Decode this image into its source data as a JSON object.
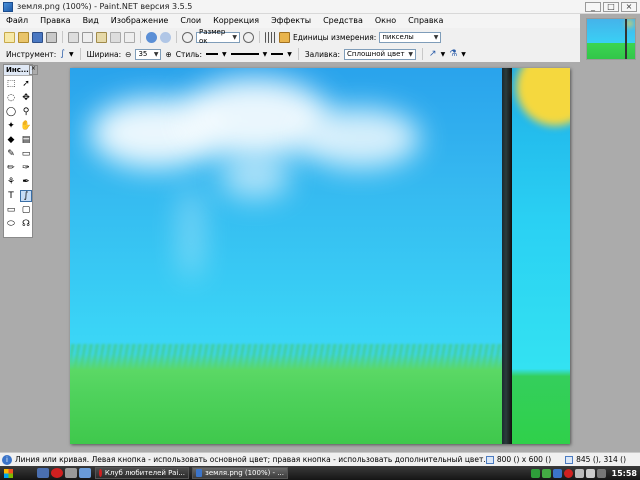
{
  "window": {
    "title": "земля.png (100%) - Paint.NET версия 3.5.5",
    "buttons": [
      "_",
      "□",
      "×"
    ]
  },
  "menu": [
    "Файл",
    "Правка",
    "Вид",
    "Изображение",
    "Слои",
    "Коррекция",
    "Эффекты",
    "Средства",
    "Окно",
    "Справка"
  ],
  "toolbar": {
    "zoom_select": "Размер ок",
    "units_label": "Единицы измерения:",
    "units_value": "пикселы"
  },
  "tool_options": {
    "tool_label": "Инструмент:",
    "width_label": "Ширина:",
    "width_value": "35",
    "style_label": "Стиль:",
    "fill_label": "Заливка:",
    "fill_value": "Сплошной цвет"
  },
  "tools_panel": {
    "title": "Инс...",
    "tools": [
      {
        "name": "rectangle-select",
        "glyph": "⬚"
      },
      {
        "name": "move-selection",
        "glyph": "➚"
      },
      {
        "name": "lasso-select",
        "glyph": "◌"
      },
      {
        "name": "move-selected",
        "glyph": "✥"
      },
      {
        "name": "ellipse-select",
        "glyph": "◯"
      },
      {
        "name": "zoom",
        "glyph": "⚲"
      },
      {
        "name": "magic-wand",
        "glyph": "✦"
      },
      {
        "name": "pan",
        "glyph": "✋"
      },
      {
        "name": "paint-bucket",
        "glyph": "◆"
      },
      {
        "name": "gradient",
        "glyph": "▤"
      },
      {
        "name": "paintbrush",
        "glyph": "✎"
      },
      {
        "name": "eraser",
        "glyph": "▭"
      },
      {
        "name": "pencil",
        "glyph": "✏"
      },
      {
        "name": "color-picker",
        "glyph": "✑"
      },
      {
        "name": "clone-stamp",
        "glyph": "⚘"
      },
      {
        "name": "recolor",
        "glyph": "✒"
      },
      {
        "name": "text",
        "glyph": "T"
      },
      {
        "name": "line-curve",
        "glyph": "∫"
      },
      {
        "name": "rectangle",
        "glyph": "▭"
      },
      {
        "name": "rounded-rectangle",
        "glyph": "▢"
      },
      {
        "name": "ellipse",
        "glyph": "⬭"
      },
      {
        "name": "freeform-shape",
        "glyph": "☊"
      }
    ]
  },
  "status": {
    "hint": "Линия или кривая. Левая кнопка - использовать основной цвет; правая кнопка - использовать дополнительный цвет.",
    "image_size": "800 () x 600 ()",
    "cursor_pos": "845 (), 314 ()"
  },
  "taskbar": {
    "tasks": [
      {
        "label": "Клуб любителей Pai...",
        "color": "#d02020"
      },
      {
        "label": "земля.png (100%) - ...",
        "color": "#3b74c9"
      }
    ],
    "clock": "15:58"
  },
  "colors": {
    "sky_top": "#2aa3ec",
    "sky_bottom": "#42dcf6",
    "grass": "#4fd25c",
    "sun": "#f5d83e"
  }
}
